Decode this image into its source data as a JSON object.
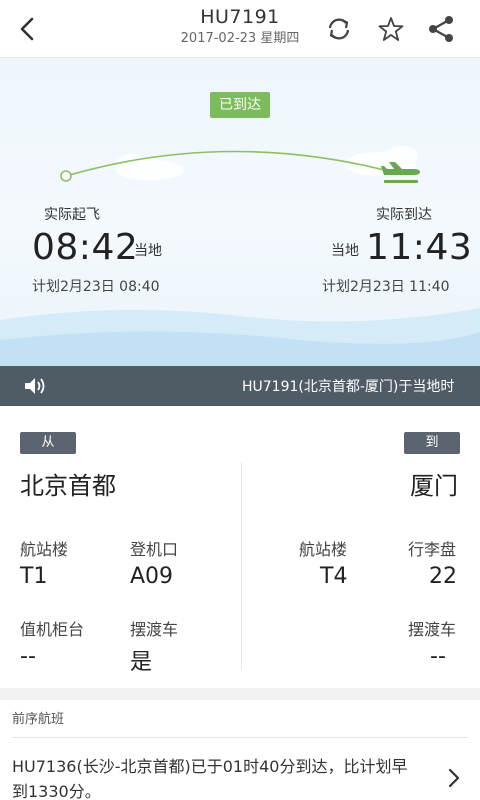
{
  "header": {
    "flight_no": "HU7191",
    "date": "2017-02-23 星期四",
    "icons": [
      "back-arrow-icon",
      "refresh-icon",
      "star-icon",
      "share-icon"
    ]
  },
  "status": {
    "badge": "已到达",
    "color": "#7dbc5d"
  },
  "departure": {
    "label": "实际起飞",
    "time": "08:42",
    "local": "当地",
    "planned": "计划2月23日 08:40"
  },
  "arrival": {
    "label": "实际到达",
    "time": "11:43",
    "local": "当地",
    "planned": "计划2月23日 11:40"
  },
  "notice": {
    "text": "HU7191(北京首都-厦门)于当地时"
  },
  "origin": {
    "tag": "从",
    "city": "北京首都",
    "terminal_label": "航站楼",
    "terminal": "T1",
    "gate_label": "登机口",
    "gate": "A09",
    "checkin_label": "值机柜台",
    "checkin": "--",
    "shuttle_label": "摆渡车",
    "shuttle": "是"
  },
  "destination": {
    "tag": "到",
    "city": "厦门",
    "terminal_label": "航站楼",
    "terminal": "T4",
    "baggage_label": "行李盘",
    "baggage": "22",
    "shuttle_label": "摆渡车",
    "shuttle": "--"
  },
  "previous": {
    "header": "前序航班",
    "text": "HU7136(长沙-北京首都)已于01时40分到达，比计划早到1330分。"
  }
}
